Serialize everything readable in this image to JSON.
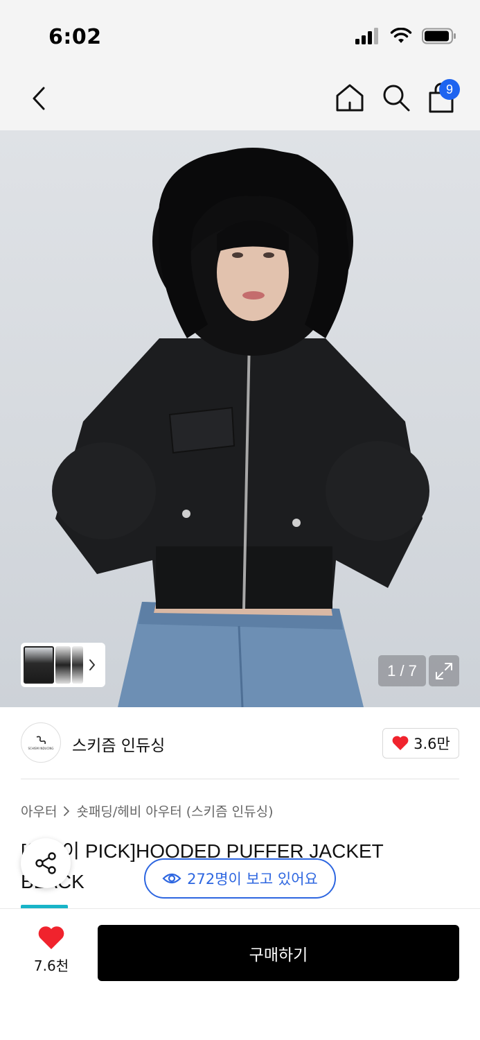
{
  "status_bar": {
    "time": "6:02"
  },
  "header": {
    "icons": [
      "chevron-left-icon",
      "home-icon",
      "search-icon",
      "shopping-bag-icon"
    ],
    "cart_badge": "9",
    "accent_color": "#1e64f0"
  },
  "gallery": {
    "counter": "1 / 7",
    "current_index": 1,
    "total": 7
  },
  "brand": {
    "name": "스키즘 인듀싱",
    "logo_text": "SCHISM INDUCING",
    "like_count": "3.6만"
  },
  "breadcrumb": {
    "items": [
      "아우터",
      "숏패딩/헤비 아우터 (스키즘 인듀싱)"
    ]
  },
  "product": {
    "title": "[이송이 PICK]HOODED PUFFER JACKET BLACK",
    "title_line1": "[이송이 PICK]HOODED PUFFER JACKET",
    "title_line2": "BLACK"
  },
  "viewers": {
    "text": "272명이 보고 있어요",
    "color": "#2d66e0"
  },
  "bottom_bar": {
    "like_count": "7.6천",
    "buy_label": "구매하기",
    "heart_color": "#f0232d"
  }
}
